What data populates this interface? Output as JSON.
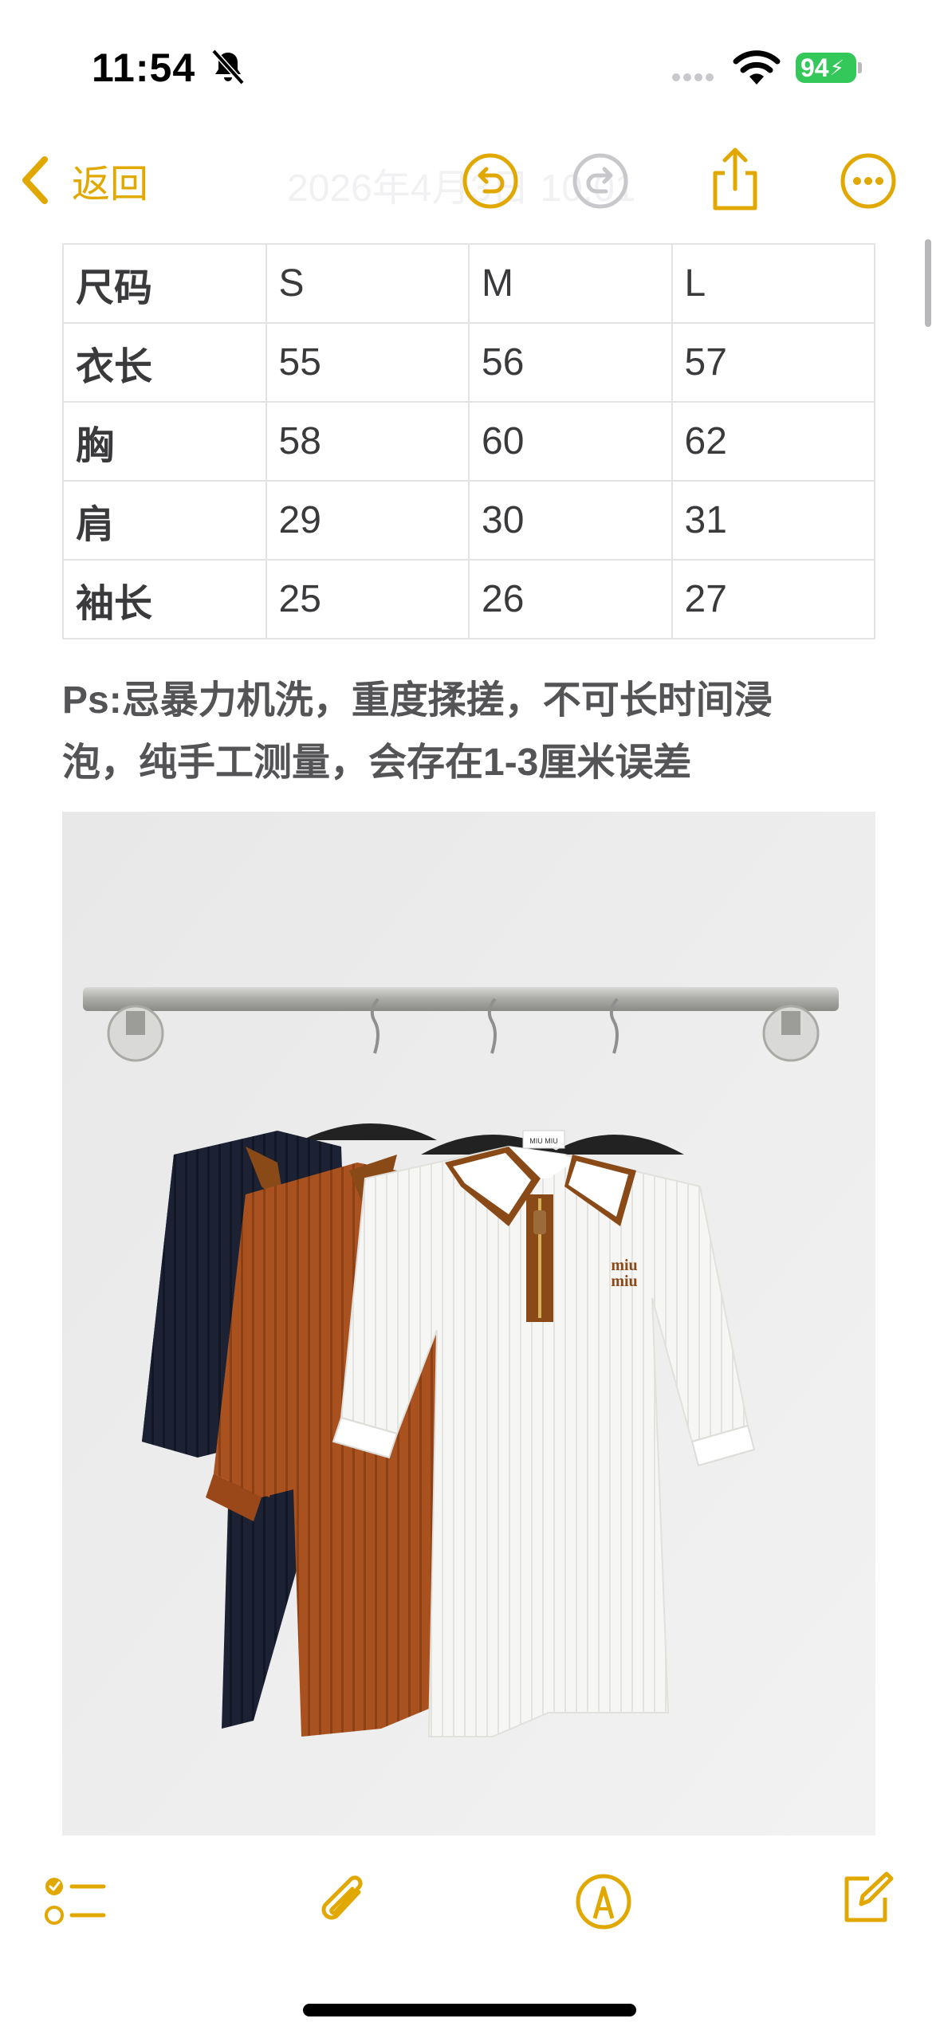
{
  "status_bar": {
    "time": "11:54",
    "battery": "94"
  },
  "nav": {
    "back_label": "返回",
    "date_text": "2026年4月3日 10:01"
  },
  "table": {
    "header": [
      "尺码",
      "S",
      "M",
      "L"
    ],
    "rows": [
      [
        "衣长",
        "55",
        "56",
        "57"
      ],
      [
        "胸",
        "58",
        "60",
        "62"
      ],
      [
        "肩",
        "29",
        "30",
        "31"
      ],
      [
        "袖长",
        "25",
        "26",
        "27"
      ]
    ]
  },
  "note": {
    "line1": "Ps:忌暴力机洗，重度揉搓，不可长时间浸",
    "line2": "泡，纯手工测量，会存在1-3厘米误差"
  },
  "photo": {
    "label_text": "MIU MIU",
    "logo_line1": "miu",
    "logo_line2": "miu"
  },
  "colors": {
    "accent": "#e0a800",
    "navy": "#1b2233",
    "rust": "#a8501f",
    "white_knit": "#f3f3f1",
    "trim_brown": "#8a4a18"
  }
}
